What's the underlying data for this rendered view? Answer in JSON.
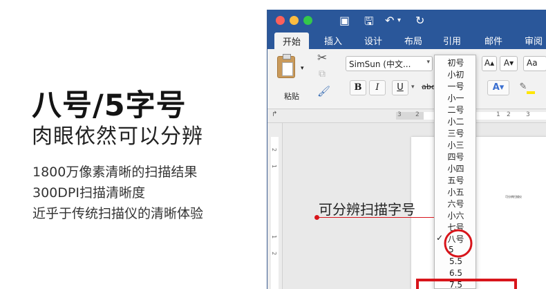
{
  "headline": "八号/5字号",
  "subline": "肉眼依然可以分辨",
  "features": [
    "1800万像素清晰的扫描结果",
    "300DPI扫描清晰度",
    "近乎于传统扫描仪的清晰体验"
  ],
  "word": {
    "tabs": [
      "开始",
      "插入",
      "设计",
      "布局",
      "引用",
      "邮件",
      "审阅"
    ],
    "paste_label": "粘贴",
    "font_name": "SimSun (中文...",
    "format_buttons": [
      "B",
      "I",
      "U",
      "abc"
    ],
    "grow_font": "A▴",
    "shrink_font": "A▾",
    "change_case": "Aa",
    "ruler_marks": [
      "3",
      "2",
      "1",
      "2",
      "3"
    ],
    "left_ruler_marks": [
      "2",
      "1",
      "1",
      "2"
    ],
    "size_options": [
      "初号",
      "小初",
      "一号",
      "小一",
      "二号",
      "小二",
      "三号",
      "小三",
      "四号",
      "小四",
      "五号",
      "小五",
      "六号",
      "小六",
      "七号",
      "八号",
      "5",
      "5.5",
      "6.5",
      "7.5"
    ],
    "selected_size": "八号",
    "tiny_text": "可分辨扫描仪"
  },
  "callout": "可分辨扫描字号",
  "colors": {
    "word_blue": "#2a579a",
    "accent_red": "#d8151b"
  }
}
